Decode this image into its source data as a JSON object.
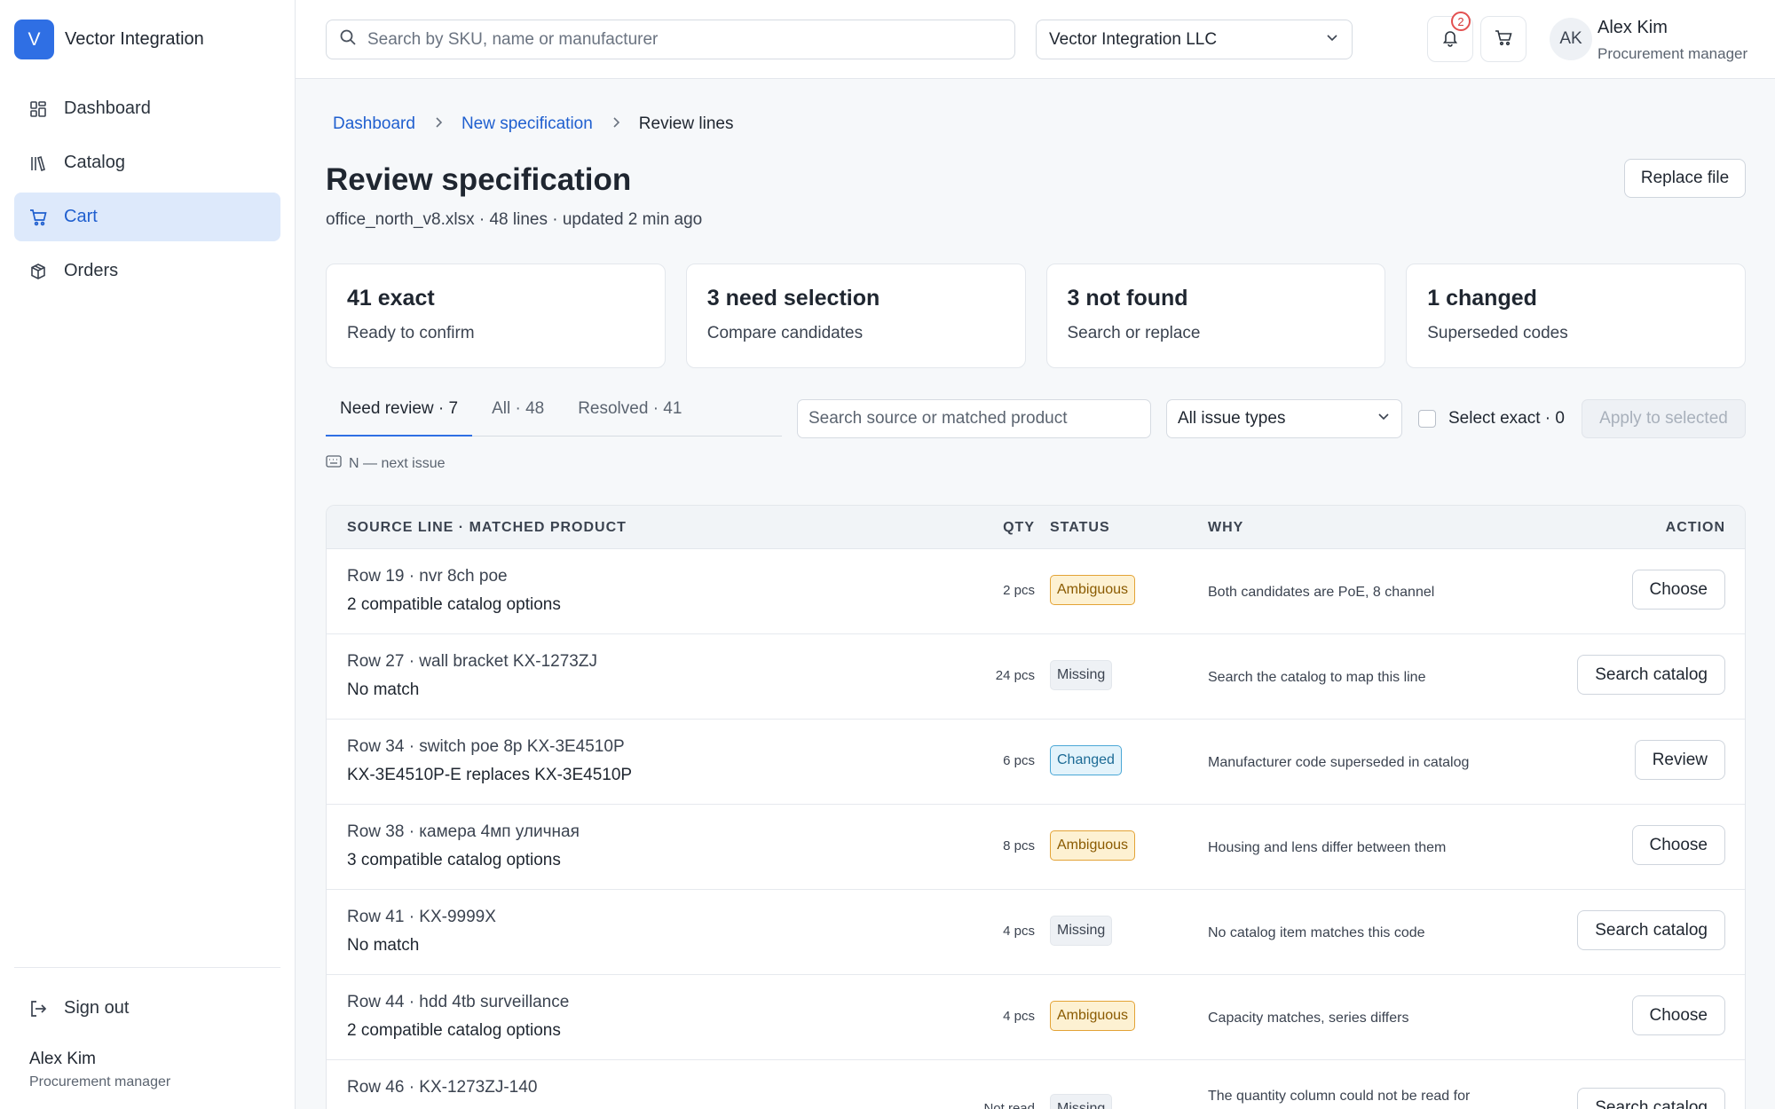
{
  "brand": {
    "logo_letter": "V",
    "name": "Vector Integration",
    "accent": "#2f6fe4"
  },
  "sidebar": {
    "items": [
      {
        "label": "Dashboard",
        "icon": "dashboard-icon",
        "active": false
      },
      {
        "label": "Catalog",
        "icon": "catalog-icon",
        "active": false
      },
      {
        "label": "Cart",
        "icon": "cart-icon",
        "active": true
      },
      {
        "label": "Orders",
        "icon": "box-icon",
        "active": false
      }
    ],
    "sign_out": "Sign out",
    "user": {
      "name": "Alex Kim",
      "role": "Procurement manager"
    }
  },
  "topbar": {
    "search_placeholder": "Search by SKU, name or manufacturer",
    "company": "Vector Integration LLC",
    "notifications_count": "2",
    "user": {
      "initials": "AK",
      "name": "Alex Kim",
      "role": "Procurement manager"
    }
  },
  "breadcrumb": {
    "items": [
      "Dashboard",
      "New specification"
    ],
    "current": "Review lines"
  },
  "page": {
    "title": "Review specification",
    "subtitle": "office_north_v8.xlsx · 48 lines · updated 2 min ago",
    "replace_button": "Replace file"
  },
  "cards": [
    {
      "big": "41 exact",
      "small": "Ready to confirm"
    },
    {
      "big": "3 need selection",
      "small": "Compare candidates"
    },
    {
      "big": "3 not found",
      "small": "Search or replace"
    },
    {
      "big": "1 changed",
      "small": "Superseded codes"
    }
  ],
  "tabs": [
    {
      "label": "Need review · 7",
      "active": true
    },
    {
      "label": "All · 48",
      "active": false
    },
    {
      "label": "Resolved · 41",
      "active": false
    }
  ],
  "filters": {
    "search_placeholder": "Search source or matched product",
    "issue_type": "All issue types",
    "select_exact": "Select exact · 0",
    "apply": "Apply to selected"
  },
  "hint": "N — next issue",
  "table": {
    "headers": {
      "source": "SOURCE LINE · MATCHED PRODUCT",
      "qty": "QTY",
      "status": "STATUS",
      "why": "WHY",
      "action": "ACTION"
    },
    "rows": [
      {
        "source": "Row 19 · nvr 8ch poe",
        "match": "2 compatible catalog options",
        "qty": "2 pcs",
        "status": "Ambiguous",
        "kind": "amb",
        "why": "Both candidates are PoE, 8 channel",
        "action": "Choose"
      },
      {
        "source": "Row 27 · wall bracket KX-1273ZJ",
        "match": "No match",
        "qty": "24 pcs",
        "status": "Missing",
        "kind": "miss",
        "why": "Search the catalog to map this line",
        "action": "Search catalog"
      },
      {
        "source": "Row 34 · switch poe 8p KX-3E4510P",
        "match": "KX-3E4510P-E replaces KX-3E4510P",
        "qty": "6 pcs",
        "status": "Changed",
        "kind": "chg",
        "why": "Manufacturer code superseded in catalog",
        "action": "Review"
      },
      {
        "source": "Row 38 · камера 4мп уличная",
        "match": "3 compatible catalog options",
        "qty": "8 pcs",
        "status": "Ambiguous",
        "kind": "amb",
        "why": "Housing and lens differ between them",
        "action": "Choose"
      },
      {
        "source": "Row 41 · KX-9999X",
        "match": "No match",
        "qty": "4 pcs",
        "status": "Missing",
        "kind": "miss",
        "why": "No catalog item matches this code",
        "action": "Search catalog"
      },
      {
        "source": "Row 44 · hdd 4tb surveillance",
        "match": "2 compatible catalog options",
        "qty": "4 pcs",
        "status": "Ambiguous",
        "kind": "amb",
        "why": "Capacity matches, series differs",
        "action": "Choose"
      },
      {
        "source": "Row 46 · KX-1273ZJ-140",
        "match": "",
        "qty": "Not read",
        "status": "Missing",
        "kind": "miss",
        "why": "The quantity column could not be read for this line",
        "action": "Search catalog"
      }
    ]
  }
}
